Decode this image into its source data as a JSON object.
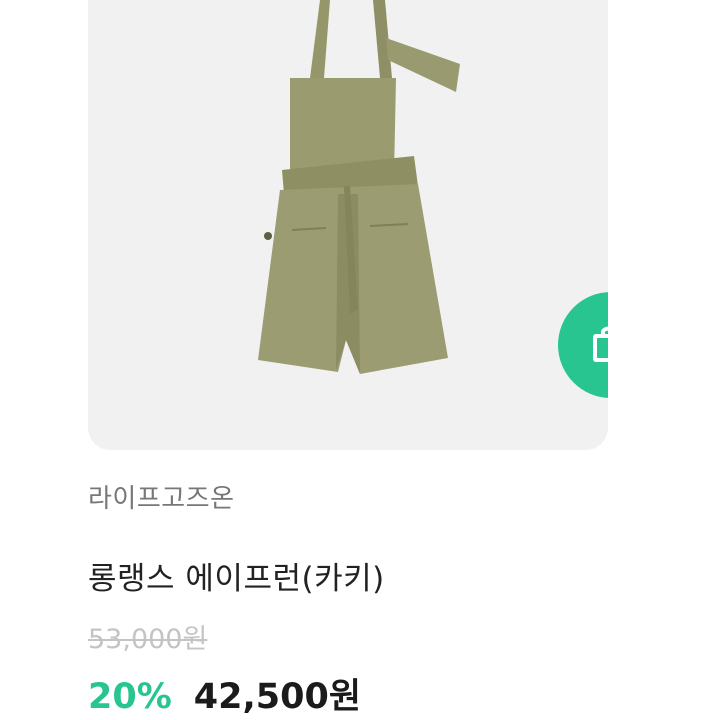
{
  "product": {
    "image_icon": "apron-photo",
    "cart_icon": "shopping-bag-icon",
    "shop_name": "라이프고즈온",
    "name": "롱랭스 에이프런(카키)",
    "original_price": "53,000원",
    "discount_rate": "20%",
    "sale_price": "42,500원"
  },
  "colors": {
    "accent": "#28c590",
    "card_background": "#f1f1f1",
    "apron": "#9a9a6f"
  }
}
